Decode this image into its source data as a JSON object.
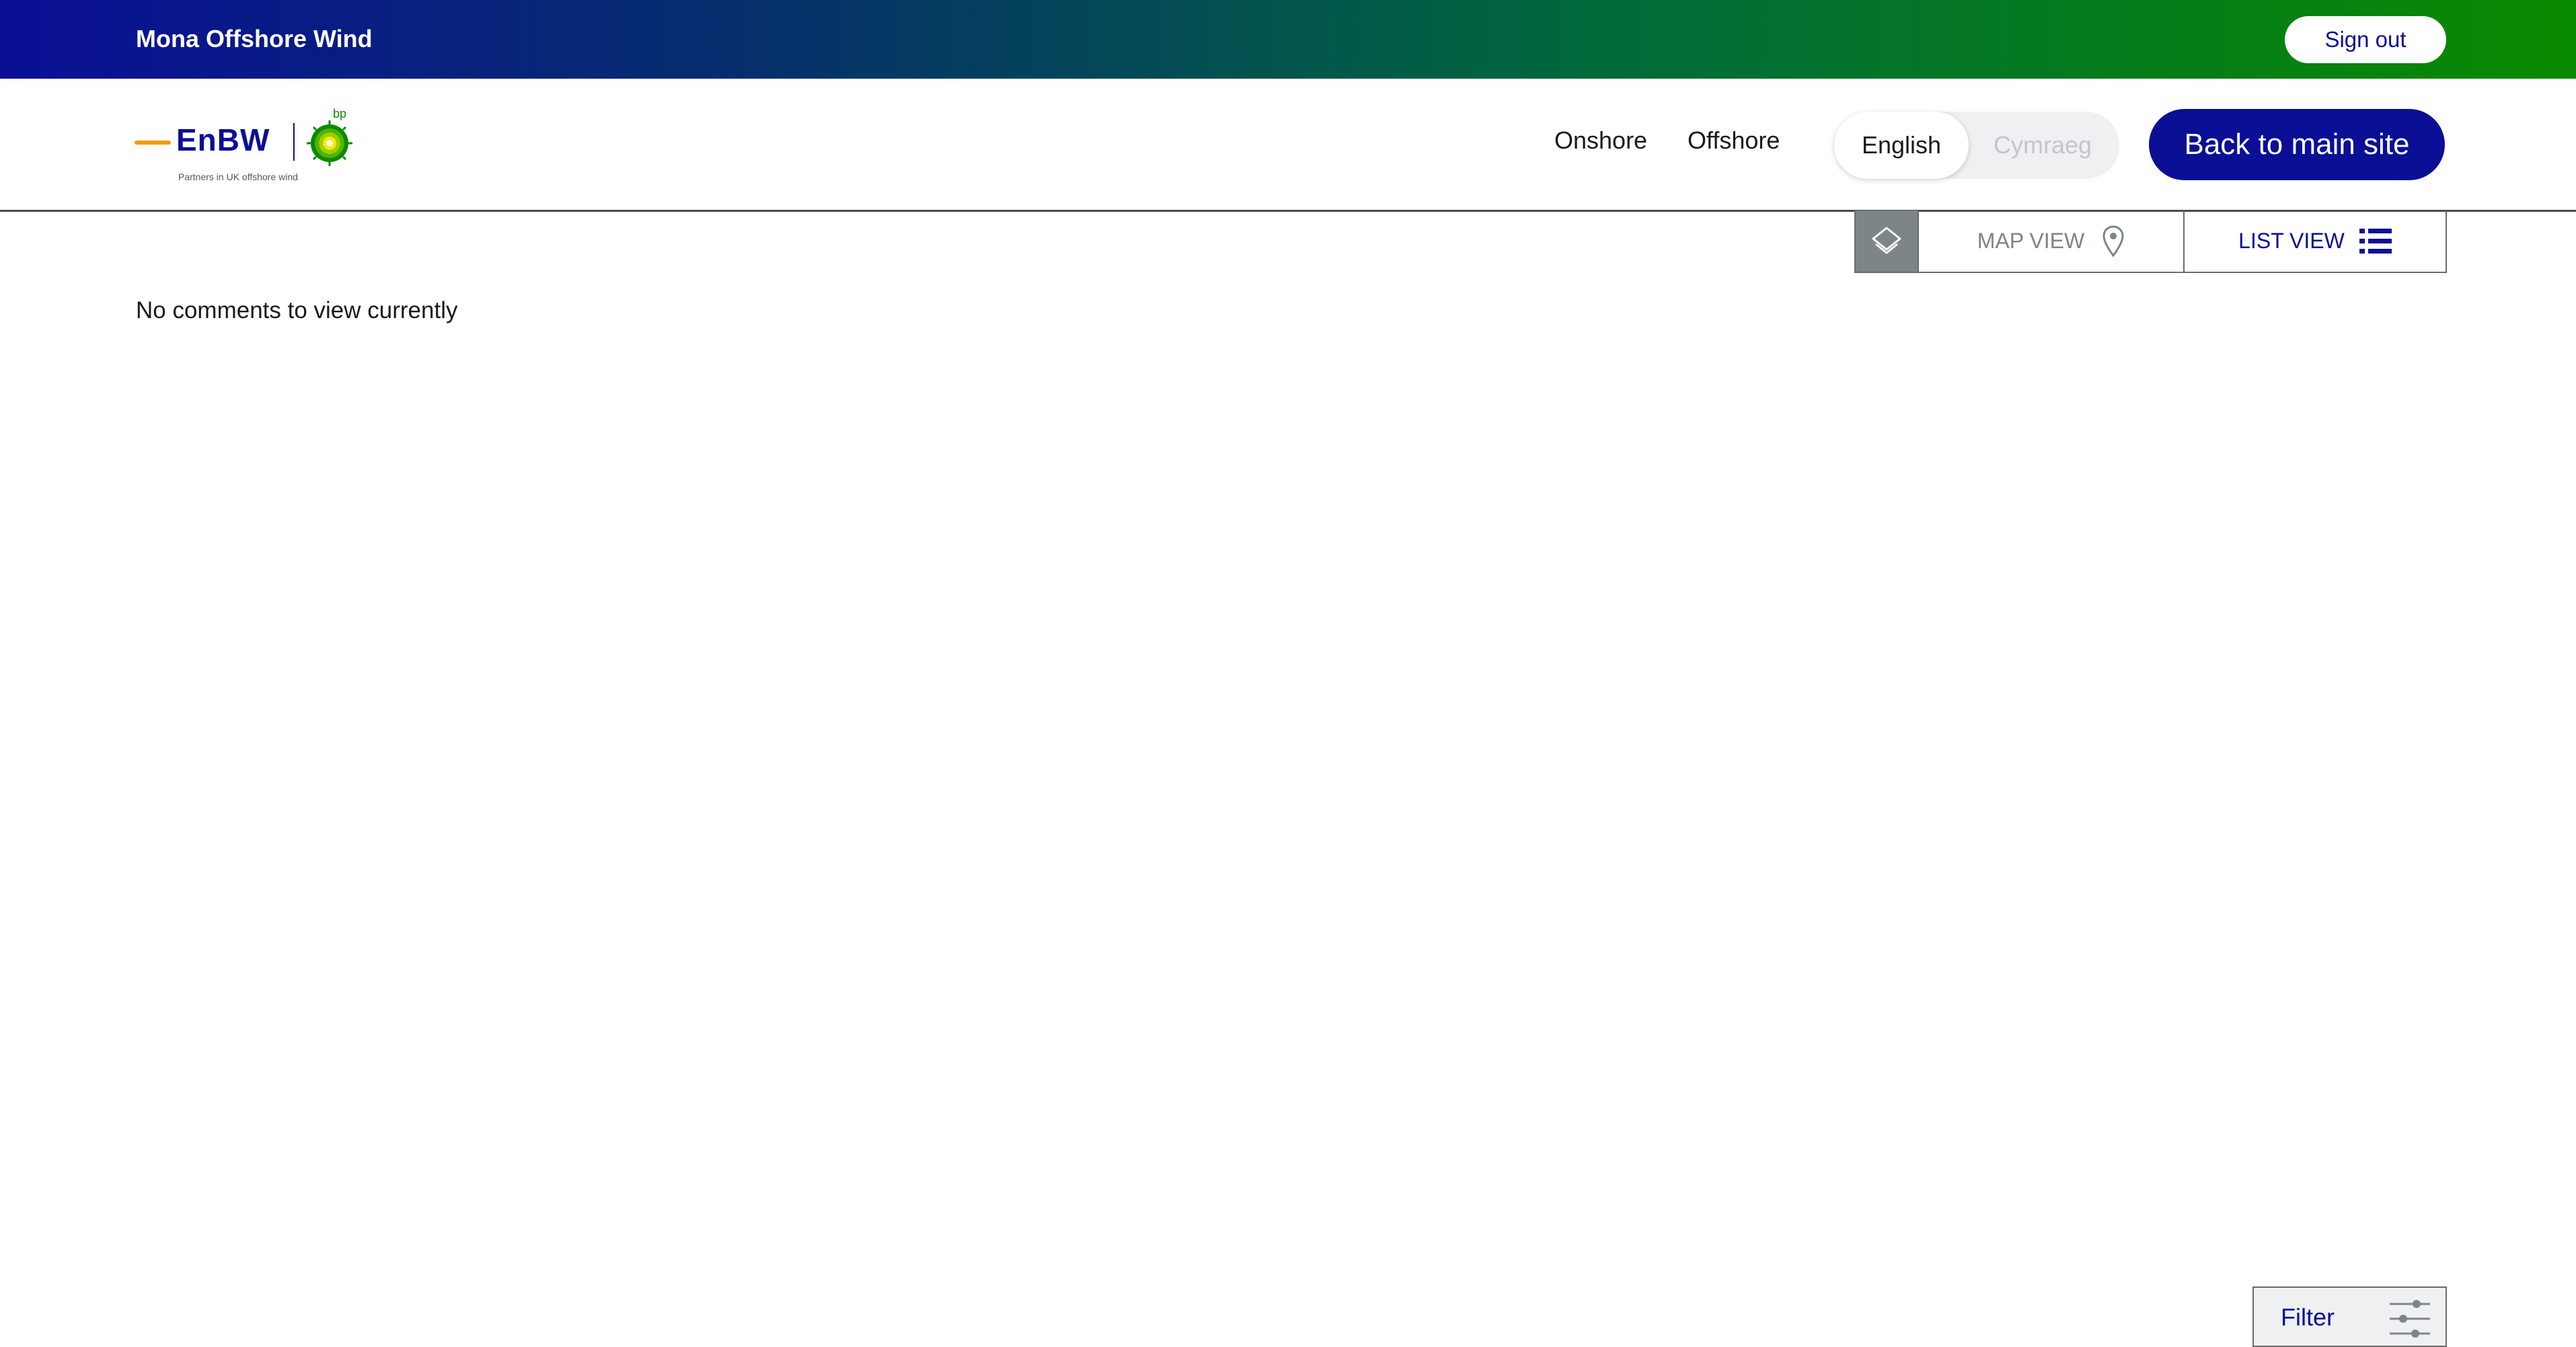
{
  "topbar": {
    "site_title": "Mona Offshore Wind",
    "signout_label": "Sign out"
  },
  "header": {
    "logo": {
      "brand_text": "EnBW",
      "partner_text": "bp",
      "tagline": "Partners in UK offshore wind"
    },
    "nav": {
      "onshore_label": "Onshore",
      "offshore_label": "Offshore"
    },
    "language": {
      "options": [
        "English",
        "Cymraeg"
      ],
      "selected": "English"
    },
    "back_label": "Back to main site"
  },
  "viewbar": {
    "layers_icon": "layers-icon",
    "map_view_label": "MAP VIEW",
    "map_view_icon": "map-pin-icon",
    "list_view_label": "LIST VIEW",
    "list_view_icon": "list-icon",
    "active_view": "LIST VIEW"
  },
  "content": {
    "empty_message": "No comments to view currently"
  },
  "filter": {
    "label": "Filter",
    "icon": "sliders-icon"
  },
  "colors": {
    "brand_blue": "#0a0f96",
    "brand_green": "#0a8a00",
    "enbw_orange": "#f59c00",
    "muted_gray": "#7d8587",
    "toggle_bg": "#eef0f2"
  }
}
